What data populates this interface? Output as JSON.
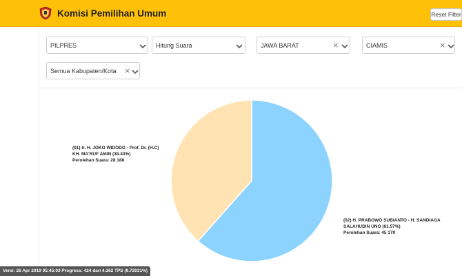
{
  "header": {
    "title": "Komisi Pemilihan Umum",
    "reset_label": "Reset Filter",
    "logo_icon": "kpu-logo-icon"
  },
  "filters": [
    {
      "value": "PILPRES",
      "clearable": false
    },
    {
      "value": "Hitung Suara",
      "clearable": false
    },
    {
      "value": "JAWA BARAT",
      "clearable": true
    },
    {
      "value": "CIAMIS",
      "clearable": true
    },
    {
      "value": "Semua Kabupaten/Kota",
      "clearable": true
    }
  ],
  "chart_data": {
    "type": "pie",
    "title": "",
    "slices": [
      {
        "label": "(01) Ir. H. JOKO WIDODO - Prof. Dr. (H.C) KH. MA'RUF AMIN",
        "percent": 38.43,
        "votes": 28188,
        "color": "#ffe3b3"
      },
      {
        "label": "(02) H. PRABOWO SUBIANTO - H. SANDIAGA SALAHUDIN UNO",
        "percent": 61.57,
        "votes": 45170,
        "color": "#8dd3ff"
      }
    ],
    "annotations": {
      "slice1": {
        "line1": "(01) Ir. H. JOKO WIDODO - Prof. Dr. (H.C)",
        "line2": "KH. MA'RUF AMIN (38.43%)",
        "line3": "Perolehan Suara: 28 188"
      },
      "slice2": {
        "line1": "(02) H. PRABOWO SUBIANTO - H. SANDIAGA",
        "line2": "SALAHUDIN UNO (61.57%)",
        "line3": "Perolehan Suara: 45 170"
      }
    }
  },
  "status": {
    "text": "Versi: 26 Apr 2019 05:45:03 Progress: 424 dari 4.362 TPS (9.72031%)"
  }
}
